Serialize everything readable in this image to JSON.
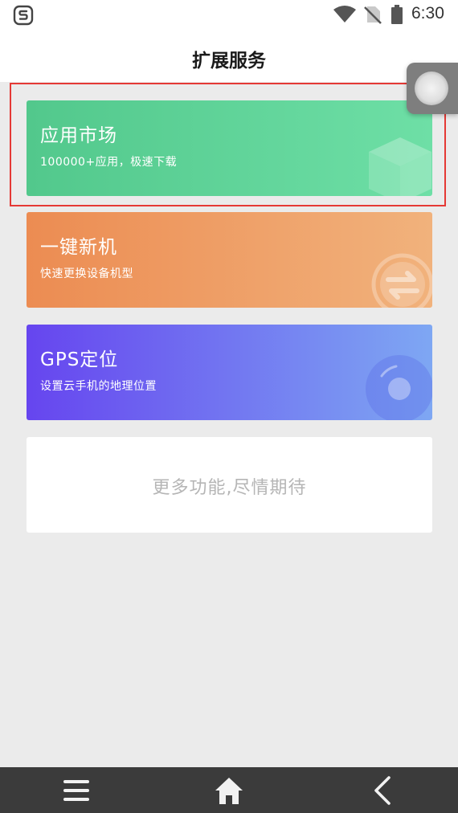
{
  "status_bar": {
    "time": "6:30",
    "icons": [
      "app-logo-icon",
      "wifi-icon",
      "no-sim-icon",
      "battery-icon"
    ]
  },
  "header": {
    "title": "扩展服务"
  },
  "cards": [
    {
      "title": "应用市场",
      "subtitle": "100000+应用，极速下载",
      "deco_icon": "cube-icon"
    },
    {
      "title": "一键新机",
      "subtitle": "快速更换设备机型",
      "deco_icon": "swap-arrows-icon"
    },
    {
      "title": "GPS定位",
      "subtitle": "设置云手机的地理位置",
      "deco_icon": "location-dot-icon"
    }
  ],
  "more": {
    "text": "更多功能,尽情期待"
  },
  "nav_bar": {
    "icons": [
      "menu-icon",
      "home-icon",
      "back-icon"
    ]
  },
  "colors": {
    "market_gradient": [
      "#52c88c",
      "#6edfa6"
    ],
    "newphone_gradient": [
      "#ec8c52",
      "#f1b27c"
    ],
    "gps_gradient": [
      "#6645ef",
      "#7ea7f3"
    ],
    "highlight": "#e53935",
    "page_background": "#ebebeb",
    "nav_background": "#3b3b3b"
  }
}
